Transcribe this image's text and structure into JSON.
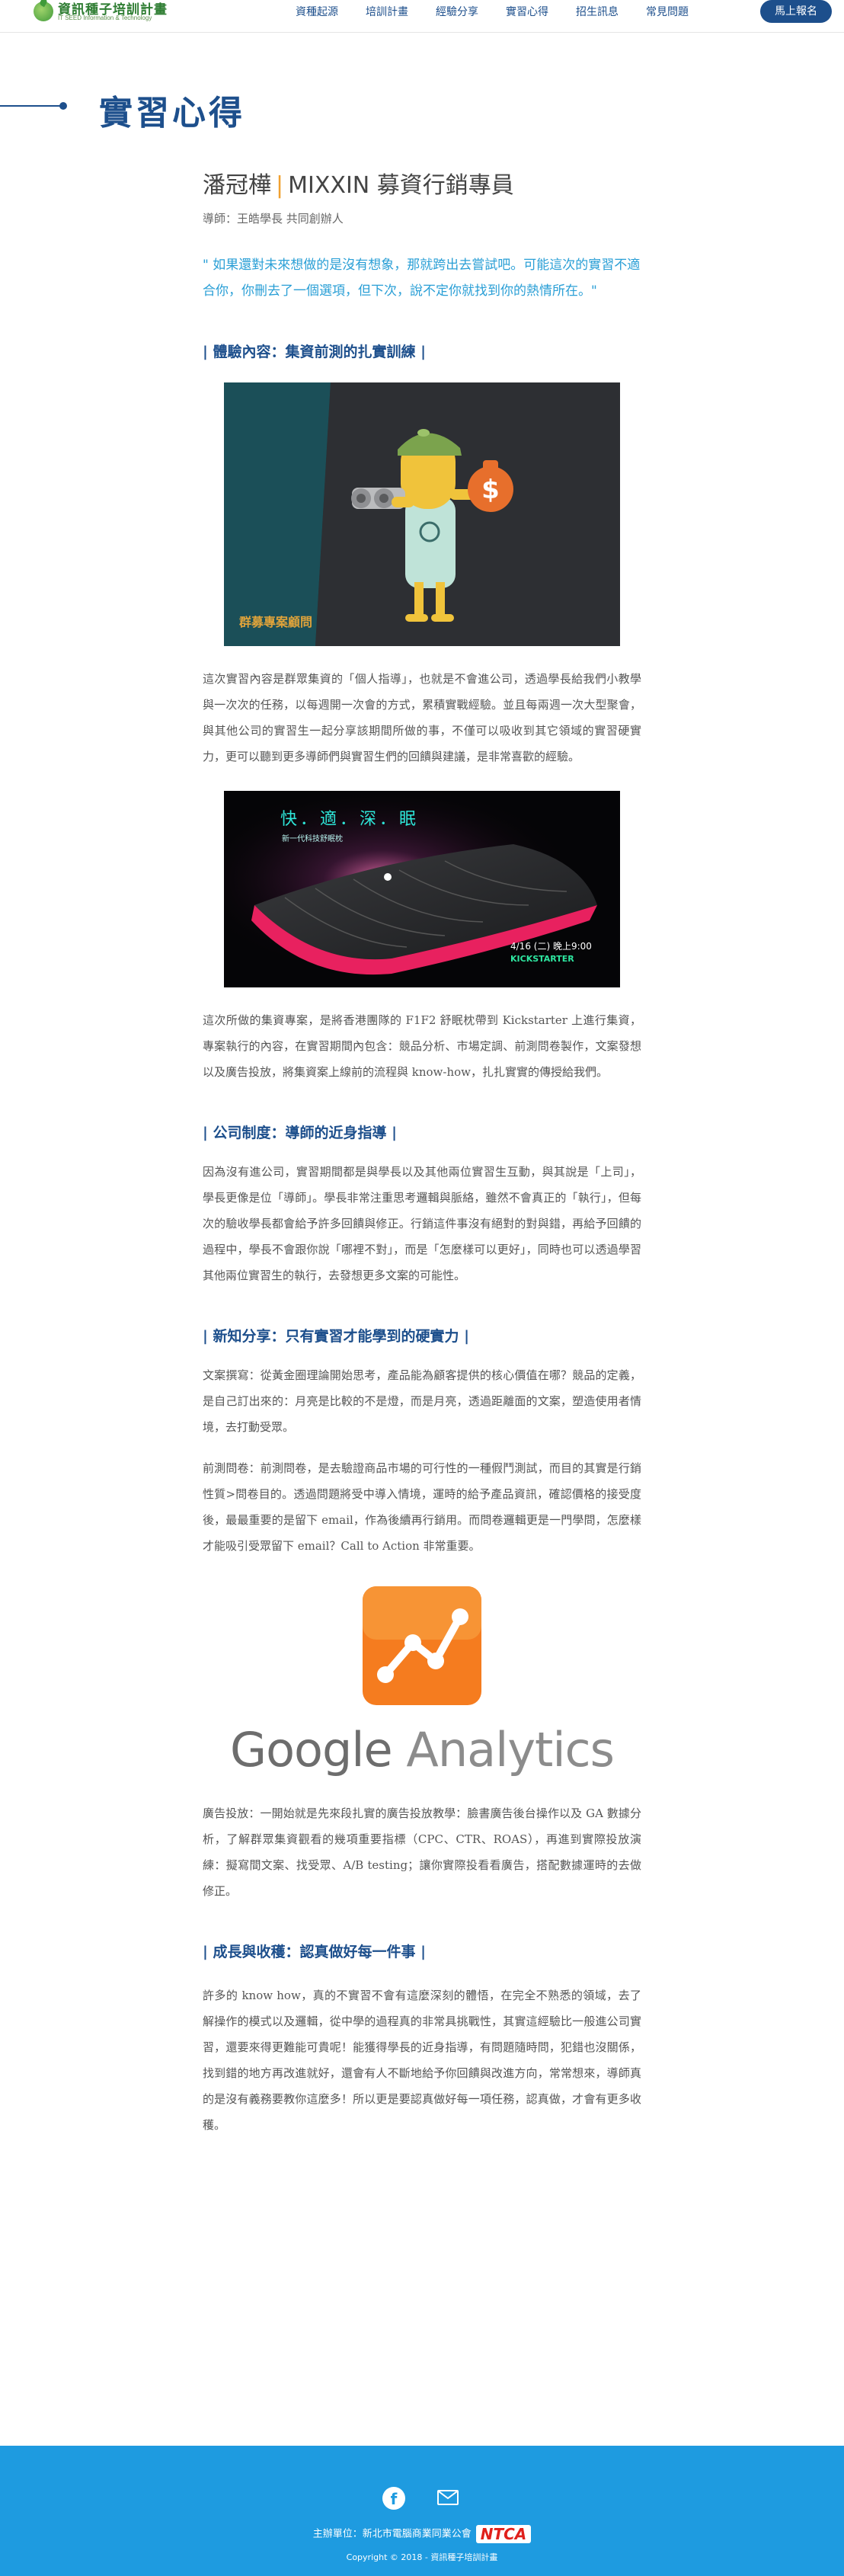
{
  "header": {
    "logo_title": "資訊種子培訓計畫",
    "logo_subtitle": "IT SEED Information & Technology",
    "nav": [
      "資種起源",
      "培訓計畫",
      "經驗分享",
      "實習心得",
      "招生訊息",
      "常見問題"
    ],
    "cta_label": "馬上報名"
  },
  "section": {
    "title": "實習心得"
  },
  "article": {
    "name": "潘冠樺",
    "separator": "|",
    "position": "MIXXIN 募資行銷專員",
    "mentor": "導師：王皓學長 共同創辦人",
    "quote": "\" 如果還對未來想做的是沒有想象，那就跨出去嘗試吧。可能這次的實習不適合你，你刪去了一個選項，但下次，說不定你就找到你的熱情所在。\"",
    "subheads": [
      "| 體驗內容：集資前測的扎實訓練 |",
      "| 公司制度：導師的近身指導 |",
      "| 新知分享：只有實習才能學到的硬實力 |",
      "| 成長與收穫：認真做好每一件事 |"
    ],
    "paragraphs": [
      "這次實習內容是群眾集資的「個人指導」，也就是不會進公司，透過學長給我們小教學與一次次的任務，以每週開一次會的方式，累積實戰經驗。並且每兩週一次大型聚會，與其他公司的實習生一起分享該期間所做的事，不僅可以吸收到其它領域的實習硬實力，更可以聽到更多導師們與實習生們的回饋與建議，是非常喜歡的經驗。",
      "這次所做的集資專案，是將香港團隊的 F1F2 舒眠枕帶到 Kickstarter 上進行集資，專案執行的內容，在實習期間內包含：競品分析、市場定調、前測問卷製作，文案發想以及廣告投放，將集資案上線前的流程與 know-how，扎扎實實的傳授給我們。",
      "因為沒有進公司，實習期間都是與學長以及其他兩位實習生互動，與其說是「上司」，學長更像是位「導師」。學長非常注重思考邏輯與脈絡，雖然不會真正的「執行」，但每次的驗收學長都會給予許多回饋與修正。行銷這件事沒有絕對的對與錯，再給予回饋的過程中，學長不會跟你說「哪裡不對」，而是「怎麼樣可以更好」，同時也可以透過學習其他兩位實習生的執行，去發想更多文案的可能性。",
      "文案撰寫：從黃金圈理論開始思考，產品能為顧客提供的核心價值在哪？競品的定義，是自己訂出來的：月亮是比較的不是燈，而是月亮，透過距離面的文案，塑造使用者情境，去打動受眾。",
      "前測問卷：前測問卷，是去驗證商品市場的可行性的一種假鬥測試，而目的其實是行銷性質>問卷目的。透過問題將受中導入情境，運時的給予產品資訊，確認價格的接受度後，最最重要的是留下 email，作為後續再行銷用。而問卷邏輯更是一門學問，怎麼樣才能吸引受眾留下 email？Call to Action 非常重要。",
      "廣告投放：一開始就是先來段扎實的廣告投放教學：臉書廣告後台操作以及 GA 數據分析，了解群眾集資觀看的幾項重要指標（CPC、CTR、ROAS），再進到實際投放演練：擬寫間文案、找受眾、A/B testing；讓你實際投看看廣告，搭配數據運時的去做修正。",
      "許多的 know how，真的不實習不會有這麼深刻的體悟，在完全不熟悉的領域，去了解操作的模式以及邏輯，從中學的過程真的非常具挑戰性，其實這經驗比一般進公司實習，還要來得更難能可貴呢！能獲得學長的近身指導，有問題隨時問，犯錯也沒關係，找到錯的地方再改進就好，還會有人不斷地給予你回饋與改進方向，常常想來，導師真的是沒有義務要教你這麼多！所以更是要認真做好每一項任務，認真做，才會有更多收穫。"
    ],
    "image1_caption": "群募專案顧問",
    "image2_headline": "快．適．深．眠",
    "image2_sub": "新一代科技舒眠枕",
    "image2_date": "4/16 (二) 晚上9:00",
    "image2_platform": "KICKSTARTER",
    "ga_logo_word1": "Google",
    "ga_logo_word2": "Analytics"
  },
  "footer": {
    "host_label": "主辦單位：新北市電腦商業同業公會",
    "host_logo": "NTCA",
    "copyright": "Copyright © 2018 - 資訊種子培訓計畫"
  },
  "colors": {
    "brand_blue": "#1d4f8c",
    "quote_blue": "#2a9fd6",
    "footer_blue": "#1e9be0",
    "separator_orange": "#f0a030",
    "ga_orange": "#f57c1f"
  }
}
